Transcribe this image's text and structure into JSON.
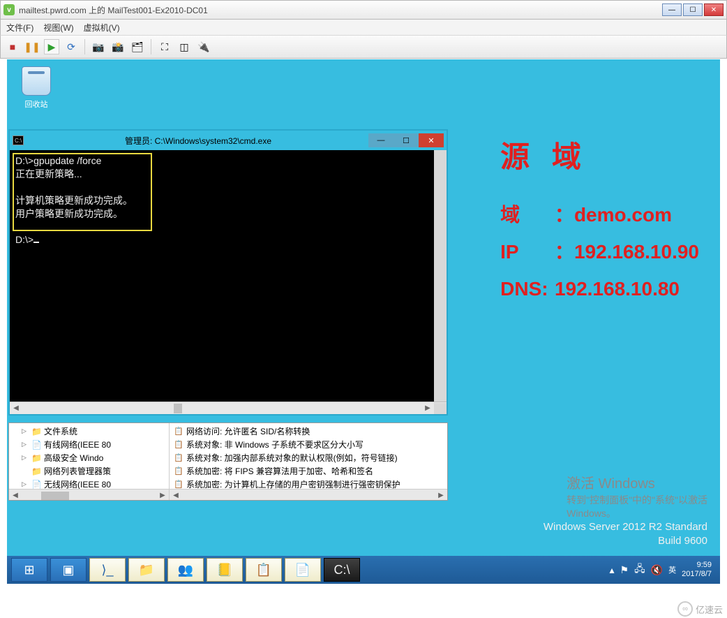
{
  "vmware": {
    "title": "mailtest.pwrd.com 上的 MailTest001-Ex2010-DC01",
    "menu": {
      "file": "文件(F)",
      "view": "视图(W)",
      "vm": "虚拟机(V)"
    }
  },
  "desktop": {
    "recycle_bin": "回收站",
    "domain": {
      "title": "源 域",
      "domain_label": "域",
      "domain_value": "demo.com",
      "ip_label": "IP",
      "ip_value": "192.168.10.90",
      "dns_label": "DNS:",
      "dns_value": "192.168.10.80"
    },
    "watermark": {
      "line1": "激活 Windows",
      "line2": "转到\"控制面板\"中的\"系统\"以激活",
      "line3": "Windows。"
    },
    "os": {
      "name": "Windows Server 2012 R2 Standard",
      "build": "Build 9600"
    }
  },
  "cmd": {
    "title": "管理员: C:\\Windows\\system32\\cmd.exe",
    "lines": {
      "l1": "D:\\>gpupdate /force",
      "l2": "正在更新策略...",
      "l3": "计算机策略更新成功完成。",
      "l4": "用户策略更新成功完成。",
      "l5": "D:\\>"
    }
  },
  "gpedit": {
    "tree": {
      "t1": "文件系统",
      "t2": "有线网络(IEEE 80",
      "t3": "高级安全 Windo",
      "t4": "网络列表管理器策",
      "t5": "无线网络(IEEE 80"
    },
    "list": {
      "r1": "网络访问: 允许匿名 SID/名称转换",
      "r2": "系统对象: 非 Windows 子系统不要求区分大小写",
      "r3": "系统对象: 加强内部系统对象的默认权限(例如，符号链接)",
      "r4": "系统加密: 将 FIPS 兼容算法用于加密、哈希和签名",
      "r5": "系统加密: 为计算机上存储的用户密钥强制进行强密钥保护"
    }
  },
  "taskbar": {
    "ime": "英",
    "time": "9:59",
    "date": "2017/8/7"
  },
  "brand": "亿速云"
}
